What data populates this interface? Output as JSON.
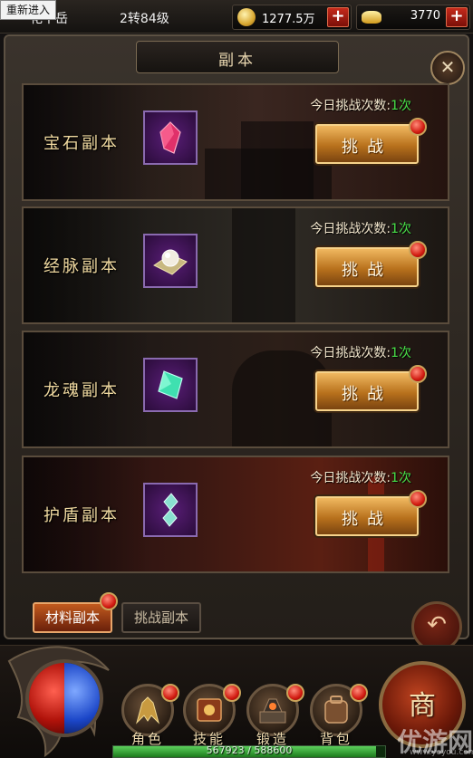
{
  "top_bar": {
    "reenter_label": "重新进入",
    "player_name": "花干岳",
    "player_level": "2转84级",
    "currency_coin": "1277.5万",
    "currency_ingot": "3770",
    "plus_symbol": "+"
  },
  "panel": {
    "title": "副本",
    "close_symbol": "✕"
  },
  "dungeons": [
    {
      "name": "宝石副本",
      "count_label": "今日挑战次数:",
      "count_value": "1次",
      "button_label": "挑战",
      "icon": "red-gem-icon",
      "gem_color": "#e0306a"
    },
    {
      "name": "经脉副本",
      "count_label": "今日挑战次数:",
      "count_value": "1次",
      "button_label": "挑战",
      "icon": "pearl-icon",
      "gem_color": "#f2ede0"
    },
    {
      "name": "龙魂副本",
      "count_label": "今日挑战次数:",
      "count_value": "1次",
      "button_label": "挑战",
      "icon": "green-crystal-icon",
      "gem_color": "#3fe0b0"
    },
    {
      "name": "护盾副本",
      "count_label": "今日挑战次数:",
      "count_value": "1次",
      "button_label": "挑战",
      "icon": "shield-crystal-icon",
      "gem_color": "#8ae0d0"
    }
  ],
  "tabs": {
    "materials_label": "材料副本",
    "challenge_label": "挑战副本",
    "active": "materials"
  },
  "hud": {
    "skills": [
      {
        "label": "角色",
        "icon": "character-icon"
      },
      {
        "label": "技能",
        "icon": "skills-icon"
      },
      {
        "label": "锻造",
        "icon": "forge-icon"
      },
      {
        "label": "背包",
        "icon": "backpack-icon"
      }
    ],
    "shop_label": "商",
    "exp_current": "567923",
    "exp_sep": "/",
    "exp_max": "588600",
    "exp_fraction": 0.965
  },
  "watermark": {
    "text": "优游网",
    "url": "www.yoyou.com"
  },
  "colors": {
    "accent_gold": "#f0b860",
    "count_green": "#48e048",
    "notify_red": "#d11a10"
  }
}
